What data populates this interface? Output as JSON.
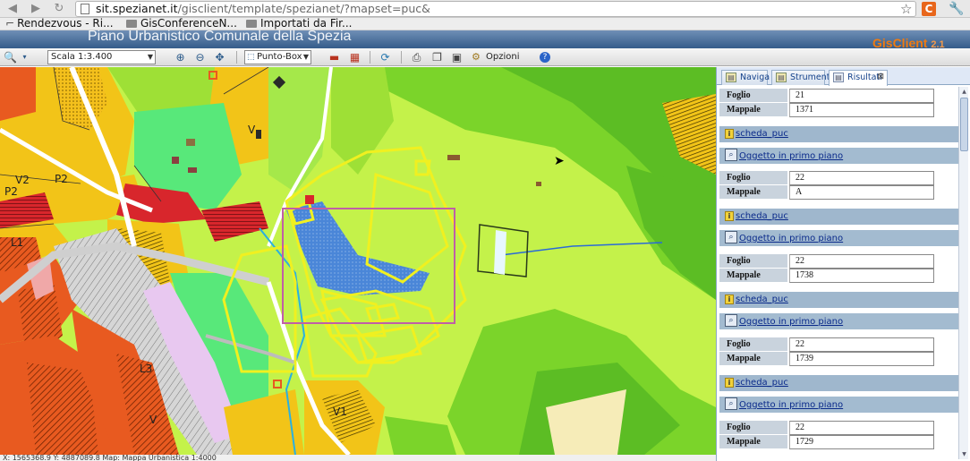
{
  "browser": {
    "url_host": "sit.spezianet.it",
    "url_path": "/gisclient/template/spezianet/?mapset=puc&",
    "bookmarks": [
      "Rendezvous - Ri...",
      "GisConferenceN...",
      "Importati da Fir..."
    ],
    "extension_letter": "C"
  },
  "app": {
    "title": "Piano Urbanistico Comunale della Spezia",
    "logo": "GisClient",
    "logo_version": "2.1",
    "accent_color": "#f07b10",
    "header_color": "#355c8a"
  },
  "toolbar": {
    "scale_value": "Scala 1:3.400",
    "select_mode": "Punto-Box",
    "options_label": "Opzioni"
  },
  "map": {
    "zone_labels": [
      "V",
      "V2",
      "P2",
      "P2",
      "L1",
      "L3",
      "V",
      "V1"
    ],
    "status_text": "X: 1565368.9 Y: 4887089.8   Map: Mappa Urbanistica 1:4000"
  },
  "panel": {
    "tabs": [
      {
        "label": "Naviga",
        "icon": "map-icon"
      },
      {
        "label": "Strumenti",
        "icon": "tools-icon"
      },
      {
        "label": "Risultati",
        "icon": "results-icon"
      }
    ],
    "key_foglio": "Foglio",
    "key_mappale": "Mappale",
    "link_scheda": "scheda_puc",
    "link_oggetto": "Oggetto in primo piano",
    "results": [
      {
        "foglio": "21",
        "mappale": "1371"
      },
      {
        "foglio": "22",
        "mappale": "A"
      },
      {
        "foglio": "22",
        "mappale": "1738"
      },
      {
        "foglio": "22",
        "mappale": "1739"
      },
      {
        "foglio": "22",
        "mappale": "1729"
      }
    ]
  }
}
